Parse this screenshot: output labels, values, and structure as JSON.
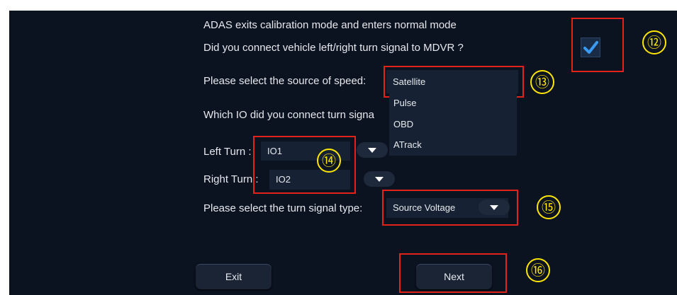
{
  "texts": {
    "adas_exit": "ADAS exits calibration mode and enters normal mode",
    "turn_signal_question": "Did you connect vehicle left/right turn signal to MDVR ?",
    "speed_source_label": "Please select the source of speed:",
    "io_question": "Which IO did you connect turn signa",
    "left_turn_label": "Left Turn :",
    "right_turn_label": "Right Turn :",
    "signal_type_label": "Please select the turn signal type:"
  },
  "turn_signal_checkbox": {
    "checked": true
  },
  "speed_source": {
    "selected": "Satellite",
    "options": [
      "Pulse",
      "OBD",
      "ATrack"
    ]
  },
  "left_turn_value": "IO1",
  "right_turn_value": "IO2",
  "signal_type_value": "Source Voltage",
  "buttons": {
    "exit": "Exit",
    "next": "Next"
  },
  "annotations": [
    "⑫",
    "⑬",
    "⑭",
    "⑮",
    "⑯"
  ],
  "colors": {
    "background": "#0b1220",
    "highlight": "#e2231a",
    "annotation": "#ffe600",
    "check": "#3a9bf4"
  }
}
